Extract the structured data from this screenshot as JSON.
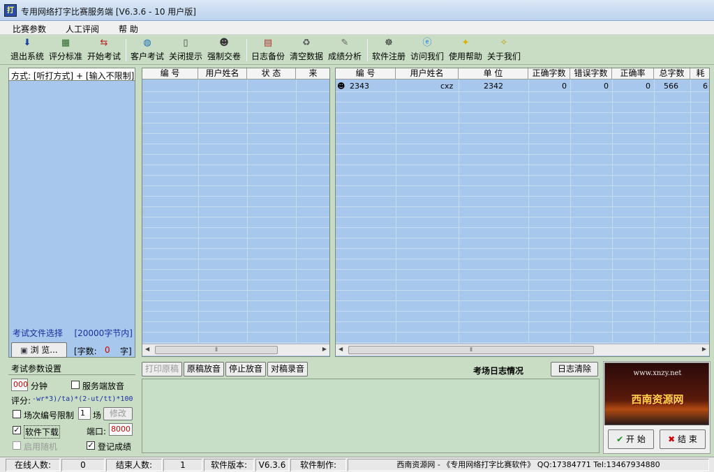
{
  "window": {
    "title": "专用网络打字比赛服务端 [V6.3.6 - 10 用户版]",
    "app_icon_text": "打"
  },
  "menu": [
    "比赛参数",
    "人工评阅",
    "帮 助"
  ],
  "toolbar": [
    {
      "label": "退出系统",
      "icon": "exit-icon"
    },
    {
      "label": "评分标准",
      "icon": "chart-icon"
    },
    {
      "label": "开始考试",
      "icon": "arrows-icon"
    },
    {
      "label": "客户考试",
      "icon": "globe-icon"
    },
    {
      "label": "关闭提示",
      "icon": "trash-icon"
    },
    {
      "label": "强制交卷",
      "icon": "users-icon"
    },
    {
      "label": "日志备份",
      "icon": "log-icon"
    },
    {
      "label": "清空数据",
      "icon": "recycle-icon"
    },
    {
      "label": "成绩分析",
      "icon": "analysis-icon"
    },
    {
      "label": "软件注册",
      "icon": "register-icon"
    },
    {
      "label": "访问我们",
      "icon": "ie-icon"
    },
    {
      "label": "使用帮助",
      "icon": "bulb-icon"
    },
    {
      "label": "关于我们",
      "icon": "about-icon"
    }
  ],
  "left_panel": {
    "mode": "方式: [听打方式] + [输入不限制]",
    "file_select": "考试文件选择",
    "file_limit": "[20000字节内]",
    "browse": "浏 览...",
    "char_count_label": "[字数:",
    "char_count": "0",
    "char_unit": "字]"
  },
  "params": {
    "title": "考试参数设置",
    "minutes_value": "000",
    "minutes_unit": "分钟",
    "server_audio": "服务端放音",
    "score_label": "评分:",
    "score_formula": "-wr*3)/ta)*(2-ut/tt)*100",
    "session_limit": "场次编号限制",
    "session_value": "1",
    "session_unit": "场",
    "modify": "修改",
    "software_download": "软件下载",
    "port_label": "端口:",
    "port_value": "8000",
    "enable_random": "启用随机",
    "register_score": "登记成绩"
  },
  "left_grid": {
    "headers": [
      "编 号",
      "用户姓名",
      "状 态",
      "来"
    ]
  },
  "right_grid": {
    "headers": [
      "编 号",
      "用户姓名",
      "单 位",
      "正确字数",
      "错误字数",
      "正确率",
      "总字数",
      "耗"
    ],
    "rows": [
      [
        "2343",
        "cxz",
        "2342",
        "0",
        "0",
        "0",
        "566",
        "6"
      ]
    ]
  },
  "log": {
    "buttons": [
      "打印原稿",
      "原稿放音",
      "停止放音",
      "对稿录音"
    ],
    "title": "考场日志情况",
    "clear": "日志清除"
  },
  "ad": {
    "url": "www.xnzy.net",
    "name": "西南资源网",
    "start": "开 始",
    "end": "结 束"
  },
  "status": [
    {
      "label": "在线人数:",
      "value": "0"
    },
    {
      "label": "结束人数:",
      "value": "1"
    },
    {
      "label": "软件版本:",
      "value": "V6.3.6"
    },
    {
      "label": "软件制作:",
      "value": "西南资源网 - 《专用网络打字比赛软件》 QQ:17384771 Tel:13467934880"
    }
  ],
  "colors": {
    "toolbar_bg": "#c8ddc4",
    "grid_bg": "#a7c7ec",
    "log_bg": "#c6dfc6",
    "accent_red": "#cc0000"
  }
}
